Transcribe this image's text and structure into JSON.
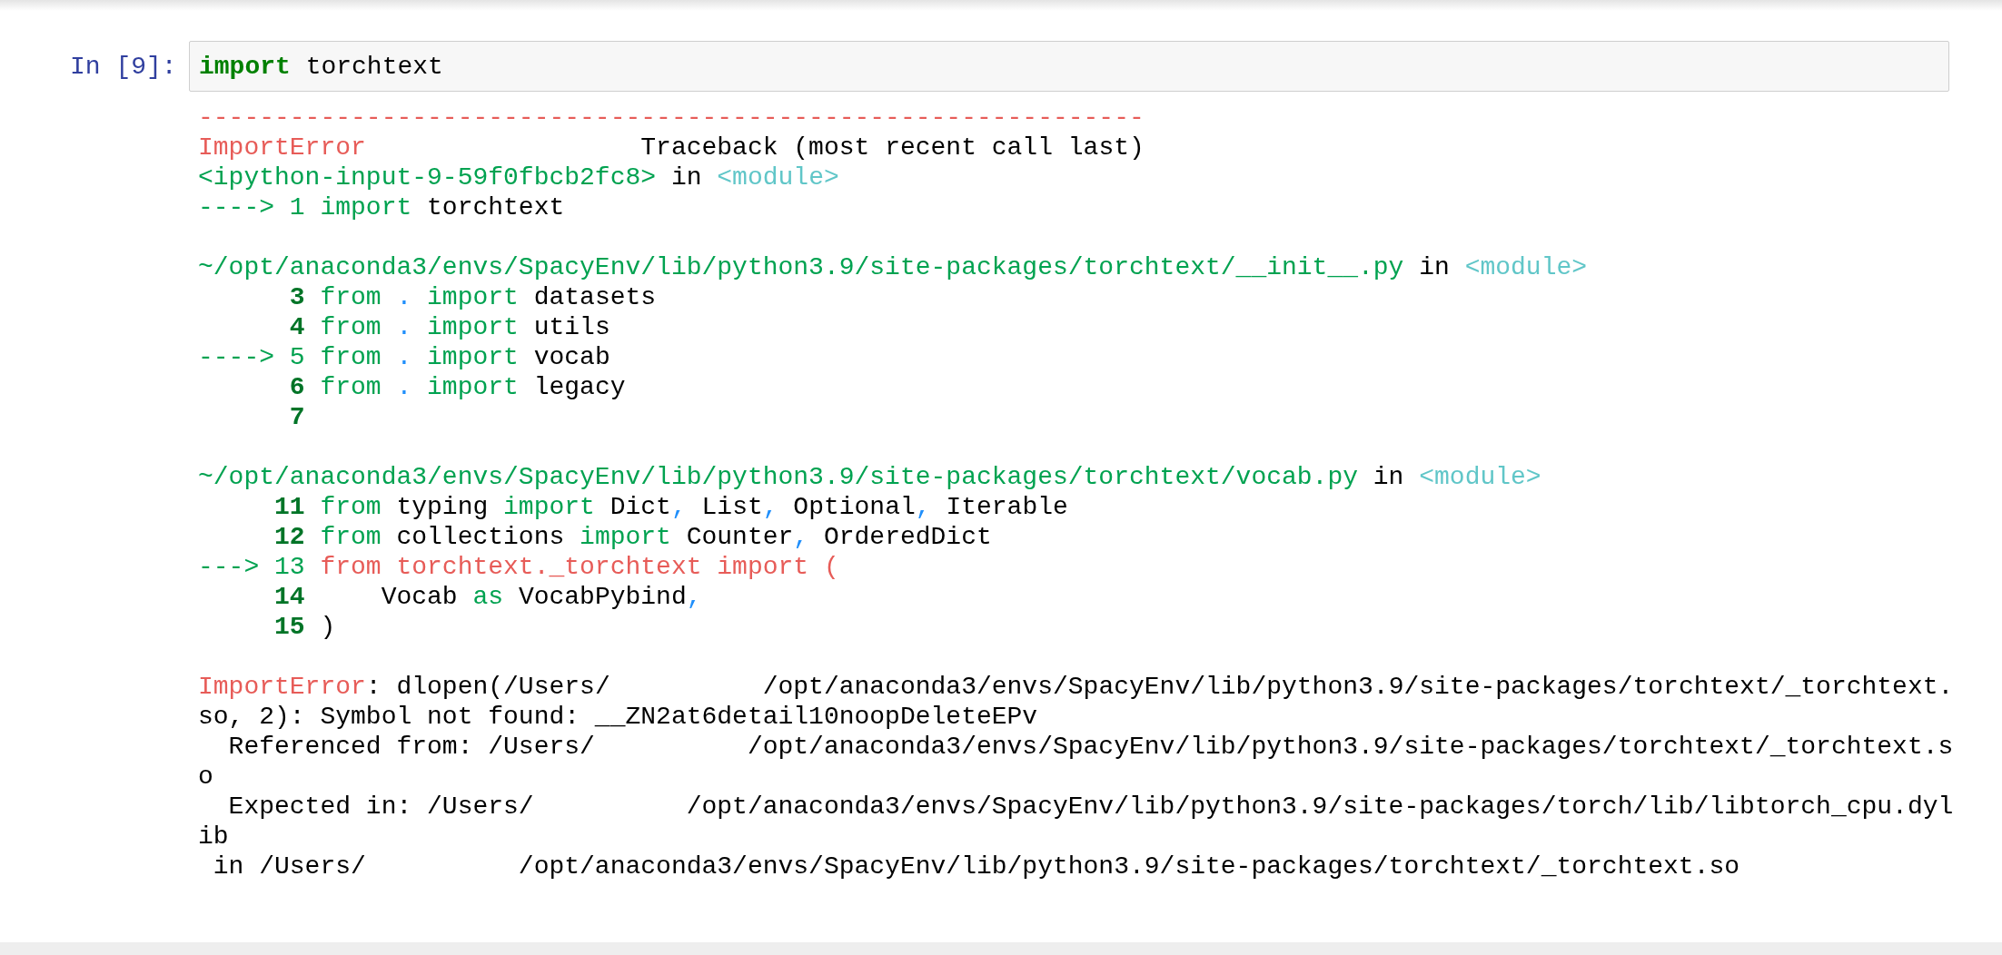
{
  "cell": {
    "prompt": "In [9]:",
    "input": [
      {
        "text": "import",
        "kind": "keyword"
      },
      {
        "text": " torchtext",
        "kind": "plain"
      }
    ]
  },
  "output": [
    {
      "kind": "code",
      "segments": [
        {
          "text": "--------------------------------------------------------------",
          "kind": "red"
        }
      ]
    },
    {
      "kind": "code",
      "segments": [
        {
          "text": "ImportError",
          "kind": "red"
        },
        {
          "text": "                  Traceback (most recent call last)",
          "kind": "plain"
        }
      ]
    },
    {
      "kind": "code",
      "segments": [
        {
          "text": "<ipython-input-9-59f0fbcb2fc8>",
          "kind": "green"
        },
        {
          "text": " in ",
          "kind": "plain"
        },
        {
          "text": "<module>",
          "kind": "cyan"
        }
      ]
    },
    {
      "kind": "code",
      "segments": [
        {
          "text": "----> 1 ",
          "kind": "green"
        },
        {
          "text": "import",
          "kind": "green"
        },
        {
          "text": " torchtext",
          "kind": "plain"
        }
      ]
    },
    {
      "kind": "blank"
    },
    {
      "kind": "code",
      "segments": [
        {
          "text": "~/opt/anaconda3/envs/SpacyEnv/lib/python3.9/site-packages/torchtext/__init__.py",
          "kind": "green"
        },
        {
          "text": " in ",
          "kind": "plain"
        },
        {
          "text": "<module>",
          "kind": "cyan"
        }
      ]
    },
    {
      "kind": "code",
      "segments": [
        {
          "text": "      3",
          "kind": "lineno"
        },
        {
          "text": " from",
          "kind": "green"
        },
        {
          "text": " .",
          "kind": "blue"
        },
        {
          "text": " import",
          "kind": "green"
        },
        {
          "text": " datasets",
          "kind": "plain"
        }
      ]
    },
    {
      "kind": "code",
      "segments": [
        {
          "text": "      4",
          "kind": "lineno"
        },
        {
          "text": " from",
          "kind": "green"
        },
        {
          "text": " .",
          "kind": "blue"
        },
        {
          "text": " import",
          "kind": "green"
        },
        {
          "text": " utils",
          "kind": "plain"
        }
      ]
    },
    {
      "kind": "code",
      "segments": [
        {
          "text": "----> 5 from",
          "kind": "green"
        },
        {
          "text": " .",
          "kind": "blue"
        },
        {
          "text": " import",
          "kind": "green"
        },
        {
          "text": " vocab",
          "kind": "plain"
        }
      ]
    },
    {
      "kind": "code",
      "segments": [
        {
          "text": "      6",
          "kind": "lineno"
        },
        {
          "text": " from",
          "kind": "green"
        },
        {
          "text": " .",
          "kind": "blue"
        },
        {
          "text": " import",
          "kind": "green"
        },
        {
          "text": " legacy",
          "kind": "plain"
        }
      ]
    },
    {
      "kind": "code",
      "segments": [
        {
          "text": "      7",
          "kind": "lineno"
        }
      ]
    },
    {
      "kind": "blank"
    },
    {
      "kind": "code",
      "segments": [
        {
          "text": "~/opt/anaconda3/envs/SpacyEnv/lib/python3.9/site-packages/torchtext/vocab.py",
          "kind": "green"
        },
        {
          "text": " in ",
          "kind": "plain"
        },
        {
          "text": "<module>",
          "kind": "cyan"
        }
      ]
    },
    {
      "kind": "code",
      "segments": [
        {
          "text": "     11",
          "kind": "lineno"
        },
        {
          "text": " from",
          "kind": "green"
        },
        {
          "text": " typing ",
          "kind": "plain"
        },
        {
          "text": "import",
          "kind": "green"
        },
        {
          "text": " Dict",
          "kind": "plain"
        },
        {
          "text": ",",
          "kind": "blue"
        },
        {
          "text": " List",
          "kind": "plain"
        },
        {
          "text": ",",
          "kind": "blue"
        },
        {
          "text": " Optional",
          "kind": "plain"
        },
        {
          "text": ",",
          "kind": "blue"
        },
        {
          "text": " Iterable",
          "kind": "plain"
        }
      ]
    },
    {
      "kind": "code",
      "segments": [
        {
          "text": "     12",
          "kind": "lineno"
        },
        {
          "text": " from",
          "kind": "green"
        },
        {
          "text": " collections ",
          "kind": "plain"
        },
        {
          "text": "import",
          "kind": "green"
        },
        {
          "text": " Counter",
          "kind": "plain"
        },
        {
          "text": ",",
          "kind": "blue"
        },
        {
          "text": " OrderedDict",
          "kind": "plain"
        }
      ]
    },
    {
      "kind": "code",
      "segments": [
        {
          "text": "---> 13 ",
          "kind": "green"
        },
        {
          "text": "from torchtext._torchtext import (",
          "kind": "red"
        }
      ]
    },
    {
      "kind": "code",
      "segments": [
        {
          "text": "     14",
          "kind": "lineno"
        },
        {
          "text": "     Vocab ",
          "kind": "plain"
        },
        {
          "text": "as",
          "kind": "green"
        },
        {
          "text": " VocabPybind",
          "kind": "plain"
        },
        {
          "text": ",",
          "kind": "blue"
        }
      ]
    },
    {
      "kind": "code",
      "segments": [
        {
          "text": "     15",
          "kind": "lineno"
        },
        {
          "text": " )",
          "kind": "plain"
        }
      ]
    },
    {
      "kind": "blank"
    },
    {
      "kind": "code",
      "segments": [
        {
          "text": "ImportError",
          "kind": "red"
        },
        {
          "text": ": dlopen(/Users/          /opt/anaconda3/envs/SpacyEnv/lib/python3.9/site-packages/torchtext/_torchtext.",
          "kind": "plain"
        }
      ]
    },
    {
      "kind": "code",
      "segments": [
        {
          "text": "so, 2): Symbol not found: __ZN2at6detail10noopDeleteEPv",
          "kind": "plain"
        }
      ]
    },
    {
      "kind": "code",
      "segments": [
        {
          "text": "  Referenced from: /Users/          /opt/anaconda3/envs/SpacyEnv/lib/python3.9/site-packages/torchtext/_torchtext.s",
          "kind": "plain"
        }
      ]
    },
    {
      "kind": "code",
      "segments": [
        {
          "text": "o",
          "kind": "plain"
        }
      ]
    },
    {
      "kind": "code",
      "segments": [
        {
          "text": "  Expected in: /Users/          /opt/anaconda3/envs/SpacyEnv/lib/python3.9/site-packages/torch/lib/libtorch_cpu.dyl",
          "kind": "plain"
        }
      ]
    },
    {
      "kind": "code",
      "segments": [
        {
          "text": "ib",
          "kind": "plain"
        }
      ]
    },
    {
      "kind": "code",
      "segments": [
        {
          "text": " in /Users/          /opt/anaconda3/envs/SpacyEnv/lib/python3.9/site-packages/torchtext/_torchtext.so",
          "kind": "plain"
        }
      ]
    }
  ]
}
